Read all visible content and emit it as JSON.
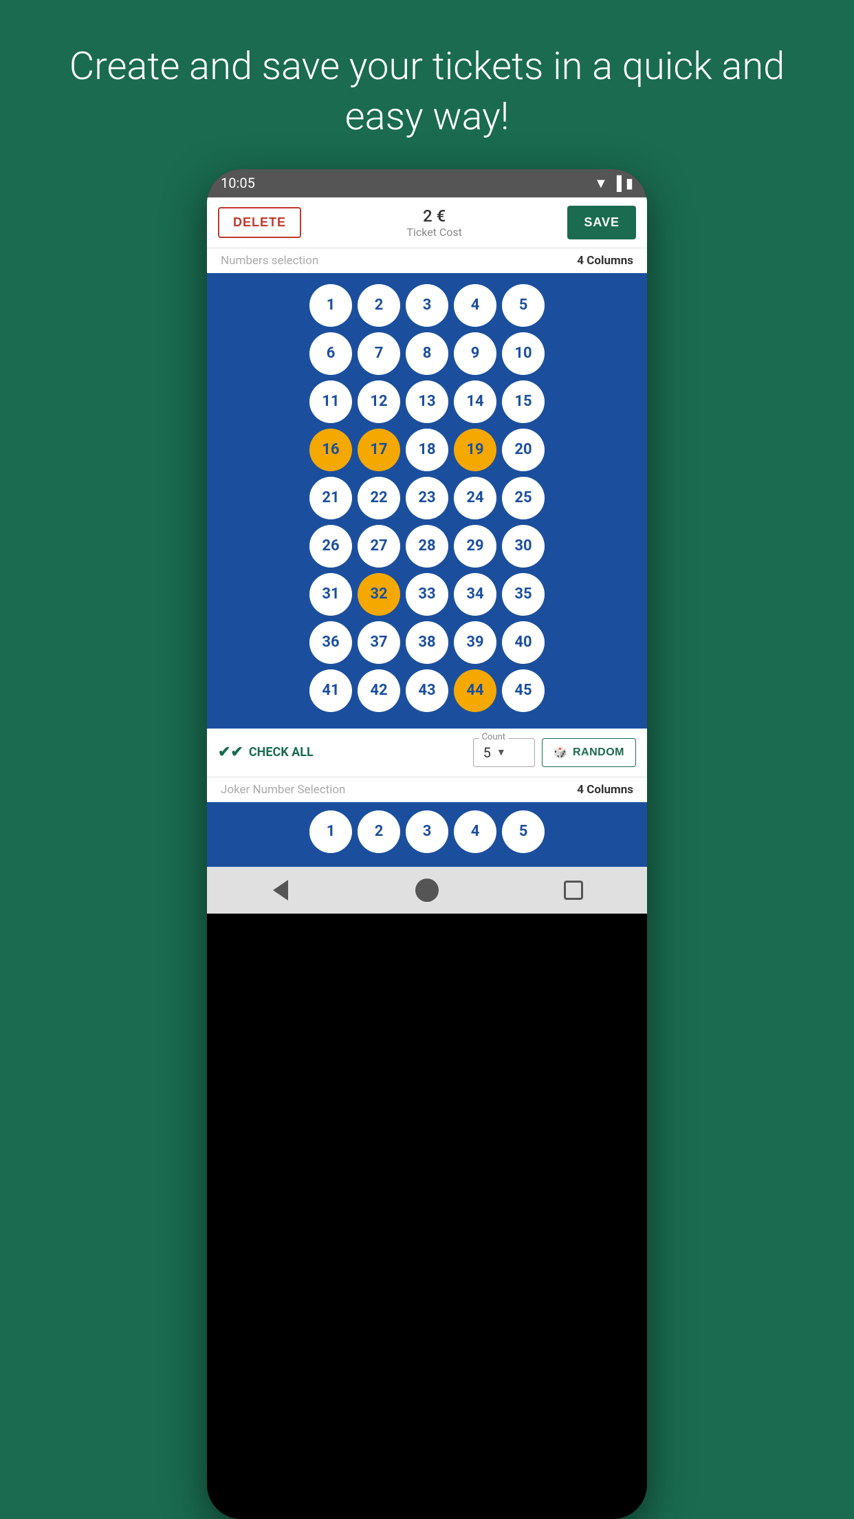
{
  "header": {
    "tagline": "Create and save your tickets in a quick and easy way!"
  },
  "statusBar": {
    "time": "10:05"
  },
  "toolbar": {
    "deleteLabel": "DELETE",
    "ticketCostValue": "2 €",
    "ticketCostLabel": "Ticket Cost",
    "saveLabel": "SAVE"
  },
  "numbersSection": {
    "label": "Numbers selection",
    "columns": "4 Columns"
  },
  "numbers": [
    {
      "value": 1,
      "selected": false
    },
    {
      "value": 2,
      "selected": false
    },
    {
      "value": 3,
      "selected": false
    },
    {
      "value": 4,
      "selected": false
    },
    {
      "value": 5,
      "selected": false
    },
    {
      "value": 6,
      "selected": false
    },
    {
      "value": 7,
      "selected": false
    },
    {
      "value": 8,
      "selected": false
    },
    {
      "value": 9,
      "selected": false
    },
    {
      "value": 10,
      "selected": false
    },
    {
      "value": 11,
      "selected": false
    },
    {
      "value": 12,
      "selected": false
    },
    {
      "value": 13,
      "selected": false
    },
    {
      "value": 14,
      "selected": false
    },
    {
      "value": 15,
      "selected": false
    },
    {
      "value": 16,
      "selected": true
    },
    {
      "value": 17,
      "selected": true
    },
    {
      "value": 18,
      "selected": false
    },
    {
      "value": 19,
      "selected": true
    },
    {
      "value": 20,
      "selected": false
    },
    {
      "value": 21,
      "selected": false
    },
    {
      "value": 22,
      "selected": false
    },
    {
      "value": 23,
      "selected": false
    },
    {
      "value": 24,
      "selected": false
    },
    {
      "value": 25,
      "selected": false
    },
    {
      "value": 26,
      "selected": false
    },
    {
      "value": 27,
      "selected": false
    },
    {
      "value": 28,
      "selected": false
    },
    {
      "value": 29,
      "selected": false
    },
    {
      "value": 30,
      "selected": false
    },
    {
      "value": 31,
      "selected": false
    },
    {
      "value": 32,
      "selected": true
    },
    {
      "value": 33,
      "selected": false
    },
    {
      "value": 34,
      "selected": false
    },
    {
      "value": 35,
      "selected": false
    },
    {
      "value": 36,
      "selected": false
    },
    {
      "value": 37,
      "selected": false
    },
    {
      "value": 38,
      "selected": false
    },
    {
      "value": 39,
      "selected": false
    },
    {
      "value": 40,
      "selected": false
    },
    {
      "value": 41,
      "selected": false
    },
    {
      "value": 42,
      "selected": false
    },
    {
      "value": 43,
      "selected": false
    },
    {
      "value": 44,
      "selected": true
    },
    {
      "value": 45,
      "selected": false
    }
  ],
  "controls": {
    "checkAllLabel": "CHECK ALL",
    "countLabel": "Count",
    "countValue": "5",
    "randomLabel": "RANDOM"
  },
  "jokerSection": {
    "label": "Joker Number Selection",
    "columns": "4 Columns"
  },
  "jokerNumbers": [
    {
      "value": 1,
      "selected": false
    },
    {
      "value": 2,
      "selected": false
    },
    {
      "value": 3,
      "selected": false
    },
    {
      "value": 4,
      "selected": false
    },
    {
      "value": 5,
      "selected": false
    }
  ],
  "navbar": {
    "backLabel": "back",
    "homeLabel": "home",
    "recentLabel": "recent"
  }
}
